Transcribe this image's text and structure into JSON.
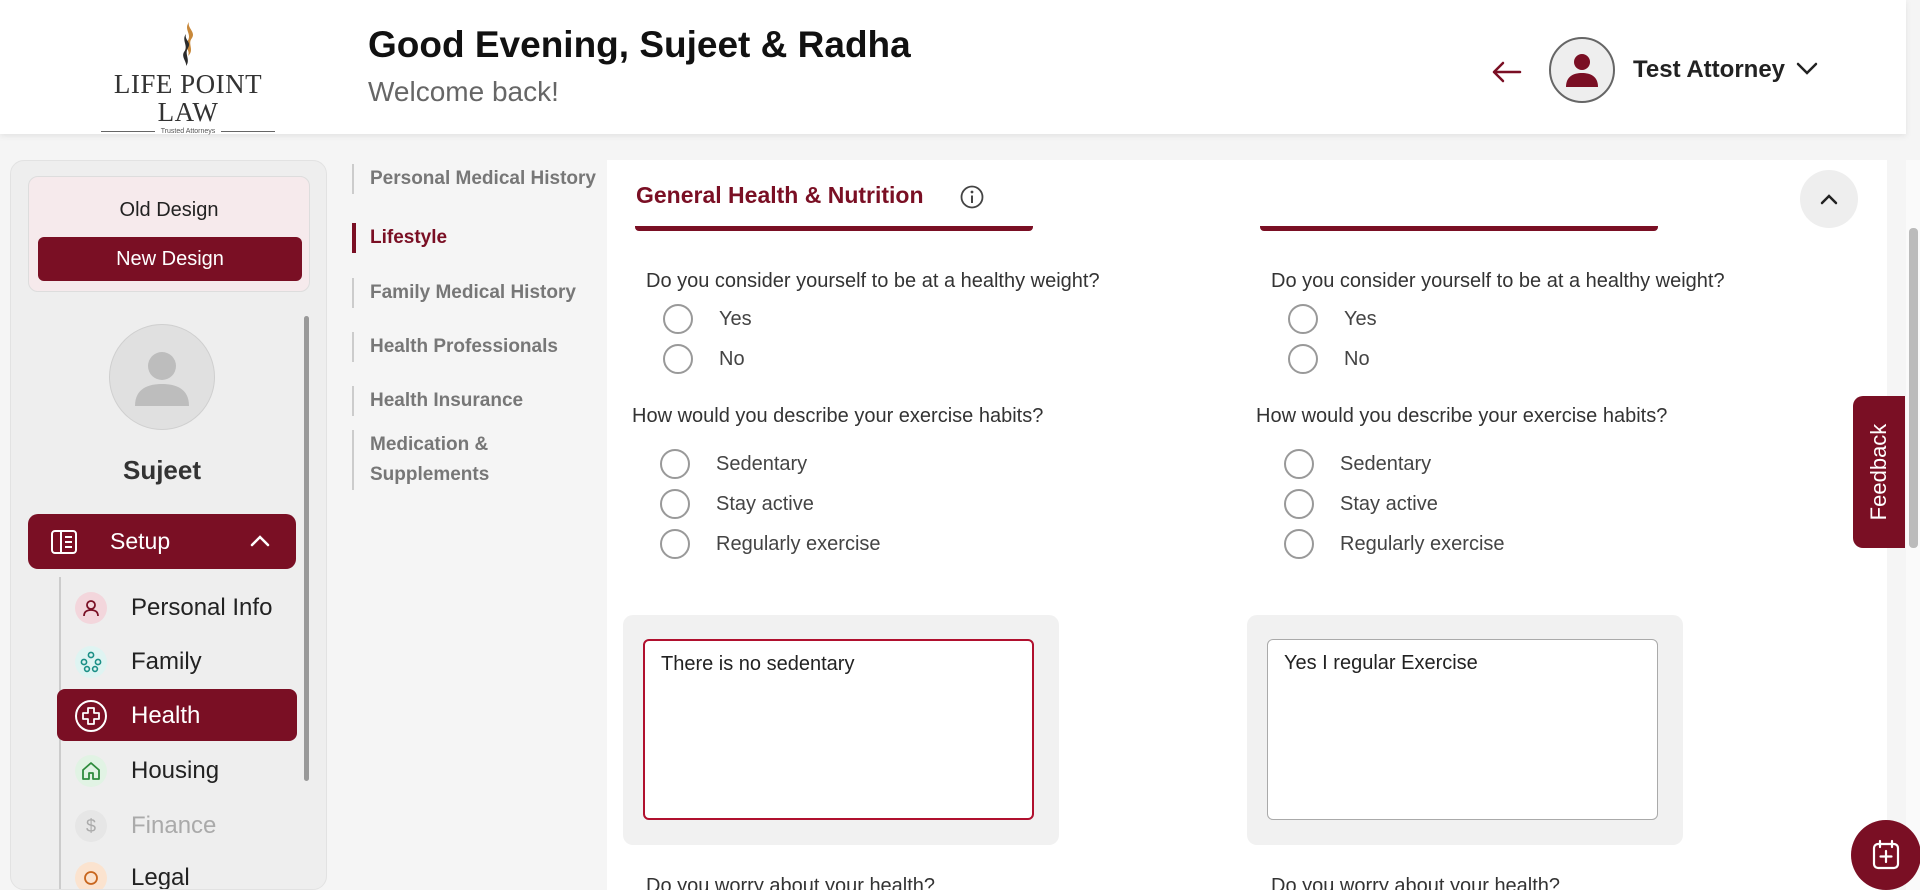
{
  "header": {
    "logo_text": "LIFE POINT LAW",
    "logo_tagline": "Trusted Attorneys",
    "greeting": "Good Evening, Sujeet & Radha",
    "subtitle": "Welcome back!",
    "back_icon": "arrow-left-icon",
    "user_name": "Test Attorney"
  },
  "sidebar": {
    "old_design": "Old Design",
    "new_design": "New Design",
    "profile_name": "Sujeet",
    "setup_label": "Setup",
    "items": [
      {
        "label": "Personal Info",
        "icon": "person-icon"
      },
      {
        "label": "Family",
        "icon": "family-icon"
      },
      {
        "label": "Health",
        "icon": "health-plus-icon"
      },
      {
        "label": "Housing",
        "icon": "home-icon"
      },
      {
        "label": "Finance",
        "icon": "dollar-icon"
      },
      {
        "label": "Legal",
        "icon": "legal-icon"
      }
    ],
    "active_item": "Health"
  },
  "section_nav": {
    "items": [
      "Personal Medical History",
      "Lifestyle",
      "Family Medical History",
      "Health Professionals",
      "Health Insurance",
      "Medication & Supplements"
    ],
    "active": "Lifestyle"
  },
  "main": {
    "section_title": "General Health & Nutrition",
    "columns": [
      {
        "q_weight": "Do you consider yourself to be at a healthy weight?",
        "weight_options": [
          "Yes",
          "No"
        ],
        "q_exercise": "How would you describe your exercise habits?",
        "exercise_options": [
          "Sedentary",
          "Stay active",
          "Regularly exercise"
        ],
        "notes": "There is no sedentary",
        "q_worry": "Do you worry about your health?"
      },
      {
        "q_weight": "Do you consider yourself to be at a healthy weight?",
        "weight_options": [
          "Yes",
          "No"
        ],
        "q_exercise": "How would you describe your exercise habits?",
        "exercise_options": [
          "Sedentary",
          "Stay active",
          "Regularly exercise"
        ],
        "notes": "Yes I regular Exercise",
        "q_worry": "Do you worry about your health?"
      }
    ]
  },
  "feedback_label": "Feedback",
  "colors": {
    "accent": "#7a0f24",
    "background": "#f5f5f5"
  }
}
